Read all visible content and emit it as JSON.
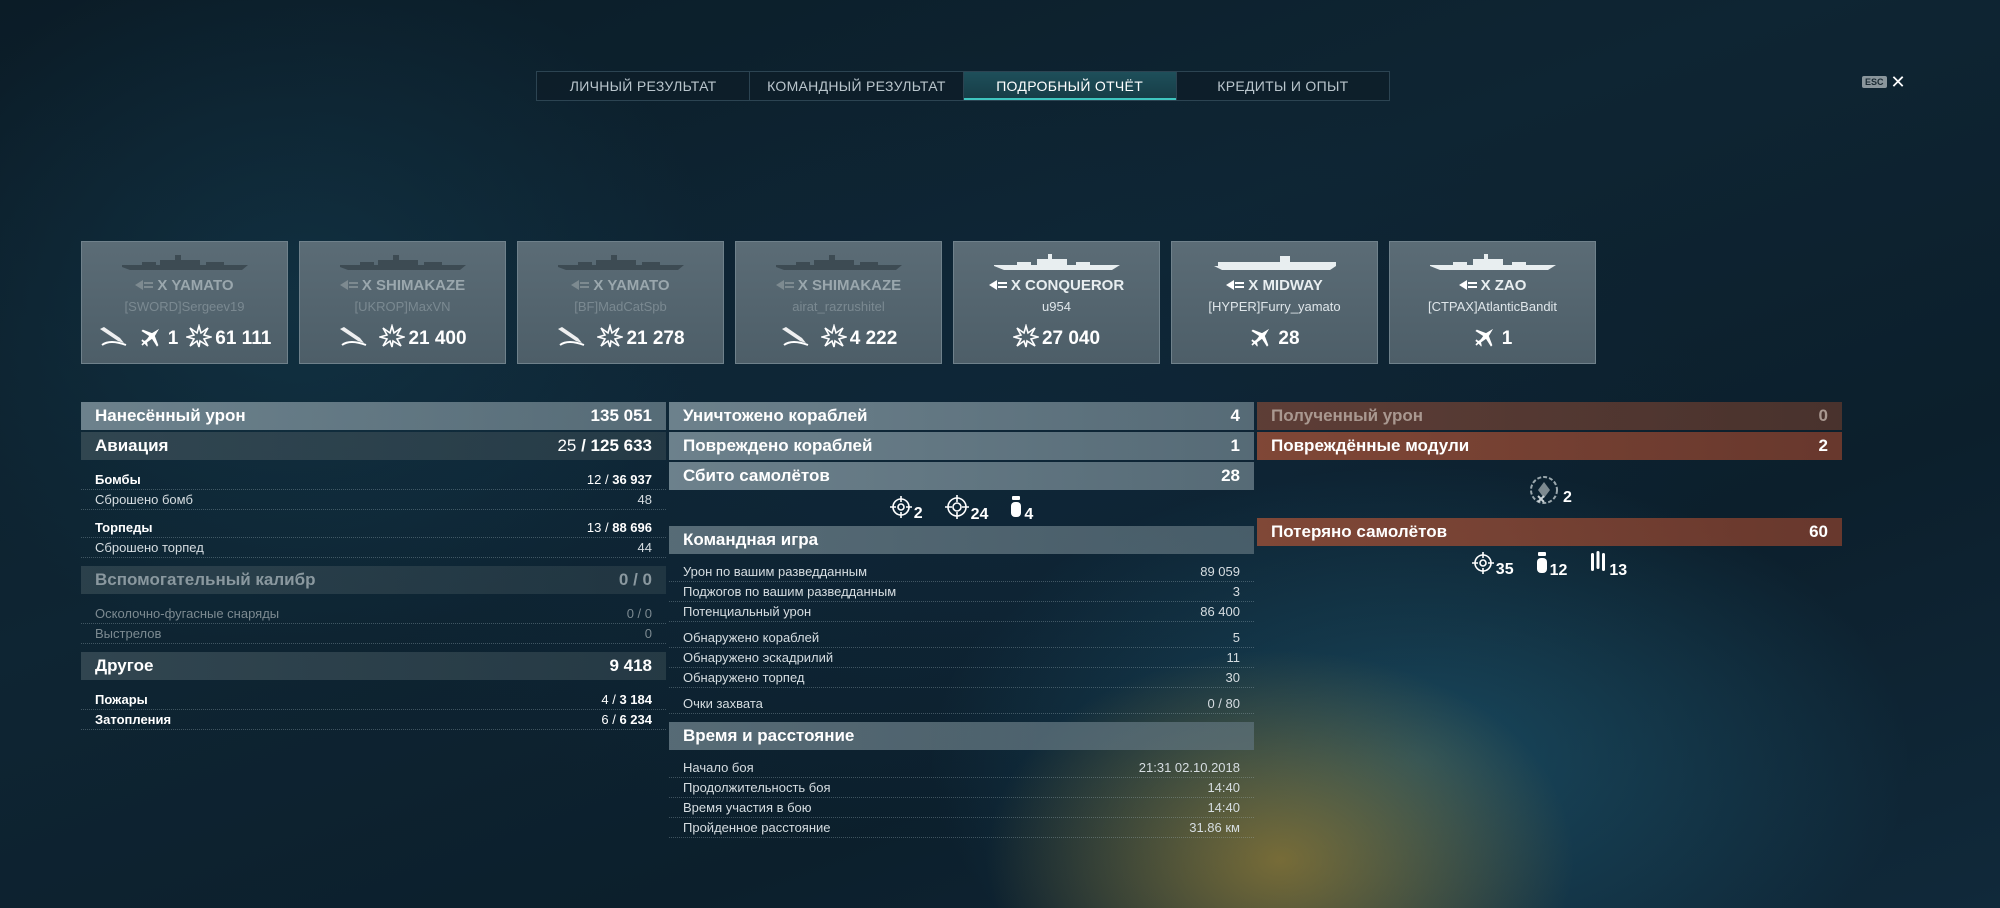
{
  "tabs": [
    {
      "label": "ЛИЧНЫЙ РЕЗУЛЬТАТ",
      "active": false
    },
    {
      "label": "КОМАНДНЫЙ РЕЗУЛЬТАТ",
      "active": false
    },
    {
      "label": "ПОДРОБНЫЙ ОТЧЁТ",
      "active": true
    },
    {
      "label": "КРЕДИТЫ И ОПЫТ",
      "active": false
    }
  ],
  "esc_key": "ESC",
  "close_glyph": "✕",
  "ships": [
    {
      "name": "X YAMATO",
      "player": "[SWORD]Sergeev19",
      "dim": true,
      "stats": [
        {
          "icon": "torpedo-hit-icon",
          "value": ""
        },
        {
          "icon": "plane-shot-icon",
          "value": "1"
        },
        {
          "icon": "damage-icon",
          "value": "61 111"
        }
      ]
    },
    {
      "name": "X SHIMAKAZE",
      "player": "[UKROP]MaxVN",
      "dim": true,
      "stats": [
        {
          "icon": "torpedo-hit-icon",
          "value": ""
        },
        {
          "icon": "damage-icon",
          "value": "21 400"
        }
      ]
    },
    {
      "name": "X YAMATO",
      "player": "[BF]MadCatSpb",
      "dim": true,
      "stats": [
        {
          "icon": "torpedo-hit-icon",
          "value": ""
        },
        {
          "icon": "damage-icon",
          "value": "21 278"
        }
      ]
    },
    {
      "name": "X SHIMAKAZE",
      "player": "airat_razrushitel",
      "dim": true,
      "stats": [
        {
          "icon": "torpedo-hit-icon",
          "value": ""
        },
        {
          "icon": "damage-icon",
          "value": "4 222"
        }
      ]
    },
    {
      "name": "X CONQUEROR",
      "player": "u954",
      "dim": false,
      "stats": [
        {
          "icon": "damage-icon",
          "value": "27 040"
        }
      ]
    },
    {
      "name": "X MIDWAY",
      "player": "[HYPER]Furry_yamato",
      "dim": false,
      "stats": [
        {
          "icon": "plane-shot-icon",
          "value": "28"
        }
      ]
    },
    {
      "name": "X ZAO",
      "player": "[CTPAX]AtlanticBandit",
      "dim": false,
      "stats": [
        {
          "icon": "plane-shot-icon",
          "value": "1"
        }
      ]
    }
  ],
  "left": {
    "damage": {
      "label": "Нанесённый урон",
      "value": "135 051"
    },
    "aviation": {
      "label": "Авиация",
      "hits": "25",
      "value": "125 633"
    },
    "bombs": {
      "label": "Бомбы",
      "hits": "12",
      "value": "36 937"
    },
    "bombs_dropped": {
      "label": "Сброшено бомб",
      "value": "48"
    },
    "torpedoes": {
      "label": "Торпеды",
      "hits": "13",
      "value": "88 696"
    },
    "torpedoes_dropped": {
      "label": "Сброшено торпед",
      "value": "44"
    },
    "secondary": {
      "label": "Вспомогательный калибр",
      "value": "0 / 0"
    },
    "he_shells": {
      "label": "Осколочно-фугасные снаряды",
      "hits": "0",
      "value": "0"
    },
    "shots": {
      "label": "Выстрелов",
      "value": "0"
    },
    "other": {
      "label": "Другое",
      "value": "9 418"
    },
    "fires": {
      "label": "Пожары",
      "hits": "4",
      "value": "3 184"
    },
    "floods": {
      "label": "Затопления",
      "hits": "6",
      "value": "6 234"
    }
  },
  "middle": {
    "destroyed": {
      "label": "Уничтожено кораблей",
      "value": "4"
    },
    "damaged": {
      "label": "Повреждено кораблей",
      "value": "1"
    },
    "planes_shot": {
      "label": "Сбито самолётов",
      "value": "28"
    },
    "plane_icons": [
      {
        "icon": "fighter-target-icon",
        "value": "2"
      },
      {
        "icon": "attack-target-icon",
        "value": "24"
      },
      {
        "icon": "bomber-icon",
        "value": "4"
      }
    ],
    "team": {
      "label": "Командная игра"
    },
    "spot_damage": {
      "label": "Урон по вашим разведданным",
      "value": "89 059"
    },
    "spot_fires": {
      "label": "Поджогов по вашим разведданным",
      "value": "3"
    },
    "potential": {
      "label": "Потенциальный урон",
      "value": "86 400"
    },
    "ships_spotted": {
      "label": "Обнаружено кораблей",
      "value": "5"
    },
    "squads_spotted": {
      "label": "Обнаружено эскадрилий",
      "value": "11"
    },
    "torps_spotted": {
      "label": "Обнаружено торпед",
      "value": "30"
    },
    "capture": {
      "label": "Очки захвата",
      "value": "0 / 80"
    },
    "time": {
      "label": "Время и расстояние"
    },
    "start": {
      "label": "Начало боя",
      "value": "21:31  02.10.2018"
    },
    "duration": {
      "label": "Продолжительность боя",
      "value": "14:40"
    },
    "participation": {
      "label": "Время участия в бою",
      "value": "14:40"
    },
    "distance": {
      "label": "Пройденное расстояние",
      "value": "31.86 км"
    }
  },
  "right": {
    "received": {
      "label": "Полученный урон",
      "value": "0"
    },
    "modules": {
      "label": "Повреждённые модули",
      "value": "2"
    },
    "module_icon_value": "2",
    "planes_lost": {
      "label": "Потеряно самолётов",
      "value": "60"
    },
    "lost_icons": [
      {
        "icon": "fighter-target-icon",
        "value": "35"
      },
      {
        "icon": "bomber-icon",
        "value": "12"
      },
      {
        "icon": "torpedo-bomber-icon",
        "value": "13"
      }
    ]
  }
}
